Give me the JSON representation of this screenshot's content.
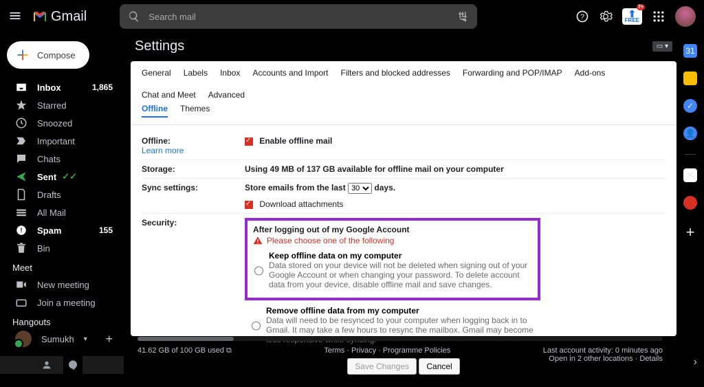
{
  "topbar": {
    "logo_text": "Gmail",
    "search_placeholder": "Search mail",
    "free_label": "FREE"
  },
  "leftnav": {
    "compose": "Compose",
    "folders": [
      {
        "name": "Inbox",
        "count": "1,865",
        "bold": true,
        "icon": "inbox"
      },
      {
        "name": "Starred",
        "count": "",
        "bold": false,
        "icon": "star"
      },
      {
        "name": "Snoozed",
        "count": "",
        "bold": false,
        "icon": "clock"
      },
      {
        "name": "Important",
        "count": "",
        "bold": false,
        "icon": "important"
      },
      {
        "name": "Chats",
        "count": "",
        "bold": false,
        "icon": "chat"
      },
      {
        "name": "Sent",
        "count": "",
        "bold": true,
        "icon": "sent"
      },
      {
        "name": "Drafts",
        "count": "",
        "bold": false,
        "icon": "draft"
      },
      {
        "name": "All Mail",
        "count": "",
        "bold": false,
        "icon": "allmail"
      },
      {
        "name": "Spam",
        "count": "155",
        "bold": true,
        "icon": "spam"
      },
      {
        "name": "Bin",
        "count": "",
        "bold": false,
        "icon": "bin"
      }
    ],
    "meet_label": "Meet",
    "new_meeting": "New meeting",
    "join_meeting": "Join a meeting",
    "hangouts_label": "Hangouts",
    "hangouts_user": "Sumukh"
  },
  "settings": {
    "title": "Settings",
    "tabs_row1": [
      "General",
      "Labels",
      "Inbox",
      "Accounts and Import",
      "Filters and blocked addresses",
      "Forwarding and POP/IMAP",
      "Add-ons",
      "Chat and Meet",
      "Advanced"
    ],
    "tabs_row2": {
      "active": "Offline",
      "other": "Themes"
    },
    "offline": {
      "label": "Offline:",
      "learn": "Learn more",
      "enable": "Enable offline mail"
    },
    "storage": {
      "label": "Storage:",
      "text": "Using 49 MB of 137 GB available for offline mail on your computer"
    },
    "sync": {
      "label": "Sync settings:",
      "prefix": "Store emails from the last",
      "days_value": "30",
      "suffix": "days.",
      "download": "Download attachments"
    },
    "security": {
      "label": "Security:",
      "heading": "After logging out of my Google Account",
      "warning": "Please choose one of the following",
      "opt1_title": "Keep offline data on my computer",
      "opt1_desc": "Data stored on your device will not be deleted when signing out of your Google Account or when changing your password. To delete account data from your device, disable offline mail and save changes.",
      "opt2_title": "Remove offline data from my computer",
      "opt2_desc": "Data will need to be resynced to your computer when logging back in to Gmail. It may take a few hours to resync the mailbox. Gmail may become less responsive while syncing."
    },
    "save": "Save Changes",
    "cancel": "Cancel"
  },
  "footer": {
    "storage": "41.62 GB of 100 GB used",
    "center": "Terms · Privacy · Programme Policies",
    "activity": "Last account activity: 0 minutes ago",
    "details": "Open in 2 other locations · Details"
  }
}
